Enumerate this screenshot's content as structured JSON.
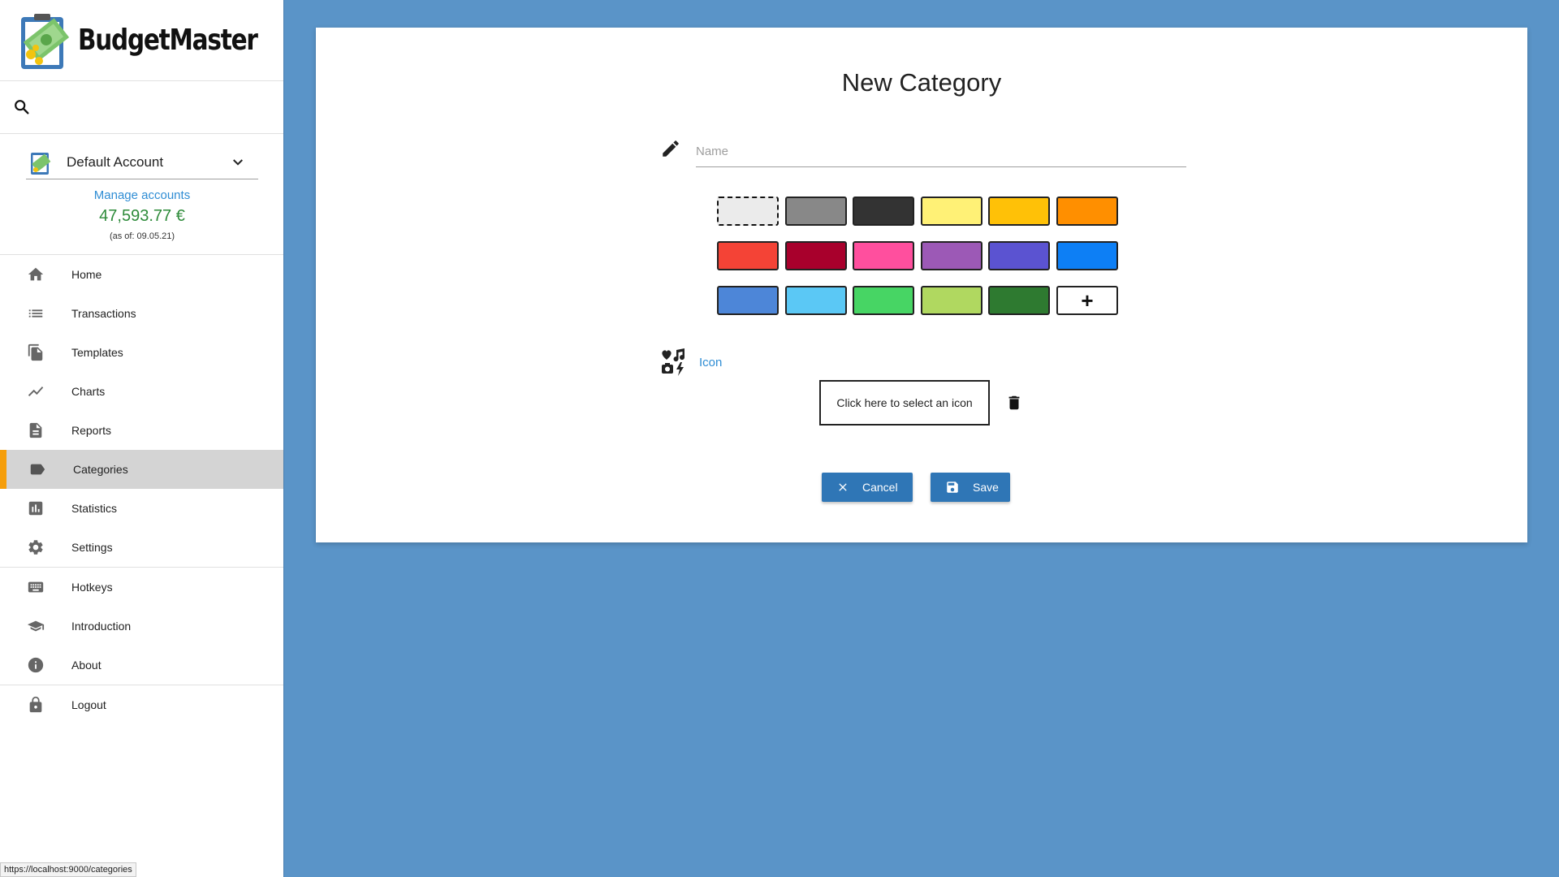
{
  "brand": {
    "name": "BudgetMaster"
  },
  "account": {
    "name": "Default Account",
    "manage_label": "Manage accounts",
    "balance": "47,593.77 €",
    "as_of": "(as of: 09.05.21)"
  },
  "nav": {
    "items": [
      {
        "label": "Home",
        "icon": "home-icon"
      },
      {
        "label": "Transactions",
        "icon": "list-icon"
      },
      {
        "label": "Templates",
        "icon": "templates-icon"
      },
      {
        "label": "Charts",
        "icon": "chart-line-icon"
      },
      {
        "label": "Reports",
        "icon": "report-icon"
      },
      {
        "label": "Categories",
        "icon": "label-icon",
        "active": true
      },
      {
        "label": "Statistics",
        "icon": "statistics-icon"
      },
      {
        "label": "Settings",
        "icon": "gear-icon"
      },
      {
        "label": "Hotkeys",
        "icon": "keyboard-icon"
      },
      {
        "label": "Introduction",
        "icon": "graduation-cap-icon"
      },
      {
        "label": "About",
        "icon": "info-icon"
      },
      {
        "label": "Logout",
        "icon": "lock-icon"
      }
    ]
  },
  "form": {
    "title": "New Category",
    "name_placeholder": "Name",
    "name_value": "",
    "colors": [
      "#ebebeb",
      "#888888",
      "#333333",
      "#fff176",
      "#ffc107",
      "#ff8f00",
      "#f44336",
      "#a8002c",
      "#ff4f9e",
      "#9c59b6",
      "#5b53d1",
      "#0d7ff5",
      "#4d86d8",
      "#5bc8f5",
      "#47d564",
      "#b0d860",
      "#2e7a30"
    ],
    "custom_color_symbol": "+",
    "icon_label": "Icon",
    "select_icon_label": "Click here to select an icon",
    "cancel_label": "Cancel",
    "save_label": "Save"
  },
  "status_bar": {
    "url": "https://localhost:9000/categories"
  }
}
